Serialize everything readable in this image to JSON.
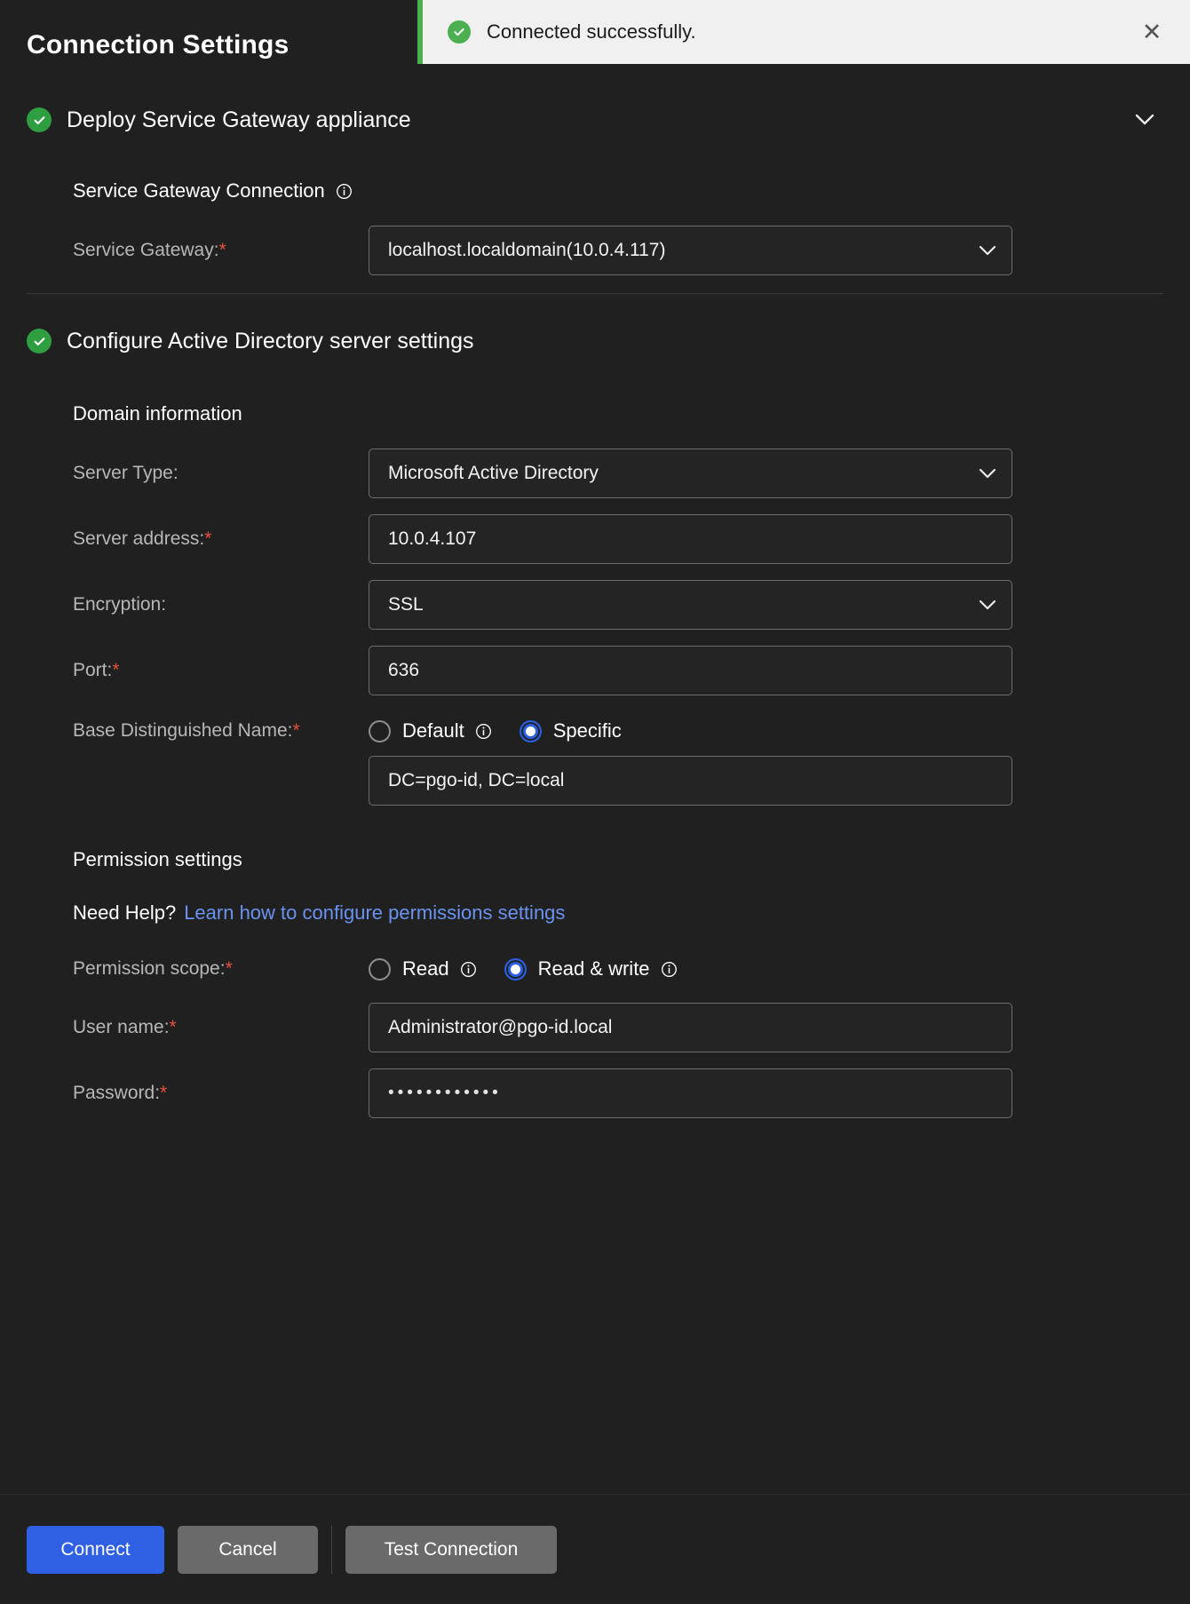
{
  "dialog": {
    "title": "Connection Settings"
  },
  "toast": {
    "message": "Connected successfully.",
    "icon": "check-circle-icon",
    "close_label": "✕",
    "accent_color": "#4caf50",
    "background": "#f0f0f0"
  },
  "sections": [
    {
      "id": "gateway",
      "title": "Deploy Service Gateway appliance",
      "status_icon": "check-circle-icon",
      "collapse_icon": "chevron-down-icon",
      "subhead": "Service Gateway Connection",
      "subhead_info_icon": "info-icon",
      "fields": [
        {
          "label": "Service Gateway:",
          "required": "*",
          "type": "select",
          "value": "localhost.localdomain(10.0.4.117)",
          "caret_icon": "chevron-down-icon"
        }
      ]
    },
    {
      "id": "active-directory",
      "title": "Configure Active Directory server settings",
      "status_icon": "check-circle-icon",
      "subhead": "Domain information",
      "fields": [
        {
          "label": "Server Type:",
          "required": "",
          "type": "select",
          "value": "Microsoft Active Directory",
          "caret_icon": "chevron-down-icon"
        },
        {
          "label": "Server address:",
          "required": "*",
          "type": "text",
          "value": "10.0.4.107"
        },
        {
          "label": "Encryption:",
          "required": "",
          "type": "select",
          "value": "SSL",
          "caret_icon": "chevron-down-icon"
        },
        {
          "label": "Port:",
          "required": "*",
          "type": "text",
          "value": "636"
        }
      ],
      "base_dn": {
        "label": "Base Distinguished Name:",
        "required": "*",
        "options": [
          {
            "label": "Default",
            "selected": false,
            "info_icon": "info-icon"
          },
          {
            "label": "Specific",
            "selected": true,
            "info_icon": ""
          }
        ],
        "value": "DC=pgo-id, DC=local"
      },
      "permissions": {
        "subhead": "Permission settings",
        "help_question": "Need Help?",
        "help_link": "Learn how to configure permissions settings",
        "scope": {
          "label": "Permission scope:",
          "required": "*",
          "options": [
            {
              "label": "Read",
              "selected": false,
              "info_icon": "info-icon"
            },
            {
              "label": "Read & write",
              "selected": true,
              "info_icon": "info-icon"
            }
          ]
        },
        "username": {
          "label": "User name:",
          "required": "*",
          "value": "Administrator@pgo-id.local"
        },
        "password": {
          "label": "Password:",
          "required": "*",
          "value": "••••••••••••"
        }
      }
    }
  ],
  "footer": {
    "connect_label": "Connect",
    "cancel_label": "Cancel",
    "test_label": "Test Connection"
  },
  "colors": {
    "accent_blue": "#2f5fe3",
    "success_green": "#2e9e41",
    "required_red": "#e8503a",
    "link_blue": "#6a92ef"
  }
}
